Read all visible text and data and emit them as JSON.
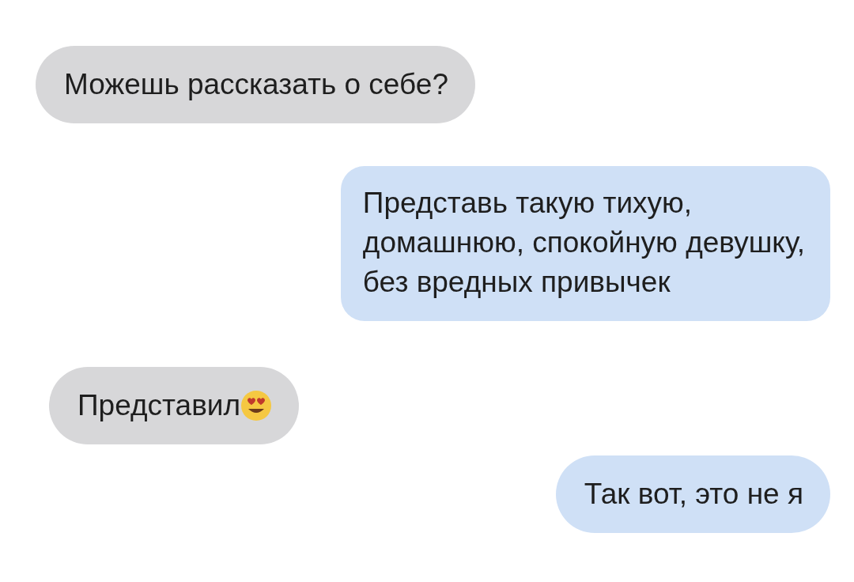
{
  "messages": [
    {
      "kind": "incoming",
      "text": "Можешь рассказать о себе?",
      "emoji": false
    },
    {
      "kind": "outgoing",
      "text": "Представь такую тихую,\nдомашнюю, спокойную девушку,\nбез вредных привычек",
      "emoji": false
    },
    {
      "kind": "incoming",
      "text": "Представил",
      "emoji": true
    },
    {
      "kind": "outgoing",
      "text": "Так вот, это не я",
      "emoji": false
    }
  ]
}
